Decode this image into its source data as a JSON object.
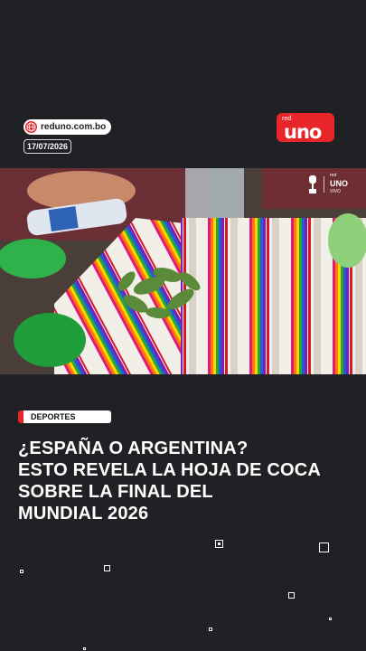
{
  "source": {
    "label": "reduno.com.bo",
    "icon": "globe-icon"
  },
  "date": "17/07/2026",
  "brand": {
    "small": "red",
    "main": "uno"
  },
  "photo_overlay": {
    "small": "red",
    "main": "UNO",
    "sub": "VIVO"
  },
  "category": "DEPORTES",
  "headline": {
    "line1": "¿ESPAÑA O ARGENTINA?",
    "line2": "ESTO REVELA LA HOJA DE COCA",
    "line3": "SOBRE LA FINAL DEL",
    "line4": "MUNDIAL 2026"
  },
  "colors": {
    "background": "#202124",
    "accent": "#e8262a",
    "text": "#ffffff"
  }
}
